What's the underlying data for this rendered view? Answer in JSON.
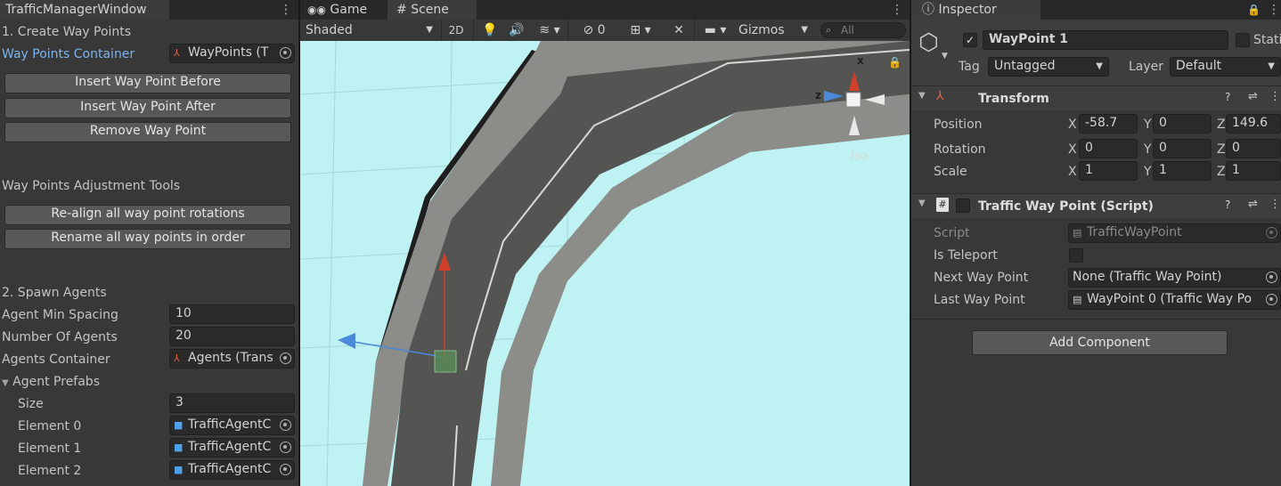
{
  "traffic_window": {
    "tab_title": "TrafficManagerWindow",
    "section_create": "1. Create Way Points",
    "waypoints_container_label": "Way Points Container",
    "waypoints_container_value": "WayPoints (T",
    "insert_before": "Insert Way Point Before",
    "insert_after": "Insert Way Point After",
    "remove": "Remove Way Point",
    "adjust_title": "Way Points Adjustment Tools",
    "realign": "Re-align all way point rotations",
    "rename": "Rename all way points in order",
    "section_spawn": "2. Spawn Agents",
    "fields": [
      {
        "label": "Agent Min Spacing",
        "value": "10"
      },
      {
        "label": "Number Of Agents",
        "value": "20"
      }
    ],
    "agents_container_label": "Agents Container",
    "agents_container_value": "Agents (Trans",
    "prefabs_label": "Agent Prefabs",
    "size_label": "Size",
    "size_value": "3",
    "elements": [
      {
        "label": "Element 0",
        "value": "TrafficAgentC"
      },
      {
        "label": "Element 1",
        "value": "TrafficAgentC"
      },
      {
        "label": "Element 2",
        "value": "TrafficAgentC"
      }
    ]
  },
  "scene_view": {
    "tab_game": "Game",
    "tab_scene": "Scene",
    "shading": "Shaded",
    "mode_2d": "2D",
    "hidden_count": "0",
    "gizmos": "Gizmos",
    "search_placeholder": "All",
    "gizmo_x": "x",
    "gizmo_z": "z",
    "gizmo_iso": "Iso",
    "sky_color": "#bff2f2",
    "road_color": "#545452",
    "curb_color": "#8c8c88"
  },
  "inspector": {
    "tab_title": "Inspector",
    "object_name": "WayPoint 1",
    "static_label": "Static",
    "tag_label": "Tag",
    "tag_value": "Untagged",
    "layer_label": "Layer",
    "layer_value": "Default",
    "transform_title": "Transform",
    "transform_rows": [
      {
        "label": "Position",
        "x": "-58.7",
        "y": "0",
        "z": "149.6"
      },
      {
        "label": "Rotation",
        "x": "0",
        "y": "0",
        "z": "0"
      },
      {
        "label": "Scale",
        "x": "1",
        "y": "1",
        "z": "1"
      }
    ],
    "axis_x": "X",
    "axis_y": "Y",
    "axis_z": "Z",
    "script_component_title": "Traffic Way Point (Script)",
    "script_label": "Script",
    "script_value": "TrafficWayPoint",
    "is_teleport_label": "Is Teleport",
    "next_label": "Next Way Point",
    "next_value": "None (Traffic Way Point)",
    "last_label": "Last Way Point",
    "last_value": "WayPoint 0 (Traffic Way Po",
    "add_component": "Add Component"
  }
}
